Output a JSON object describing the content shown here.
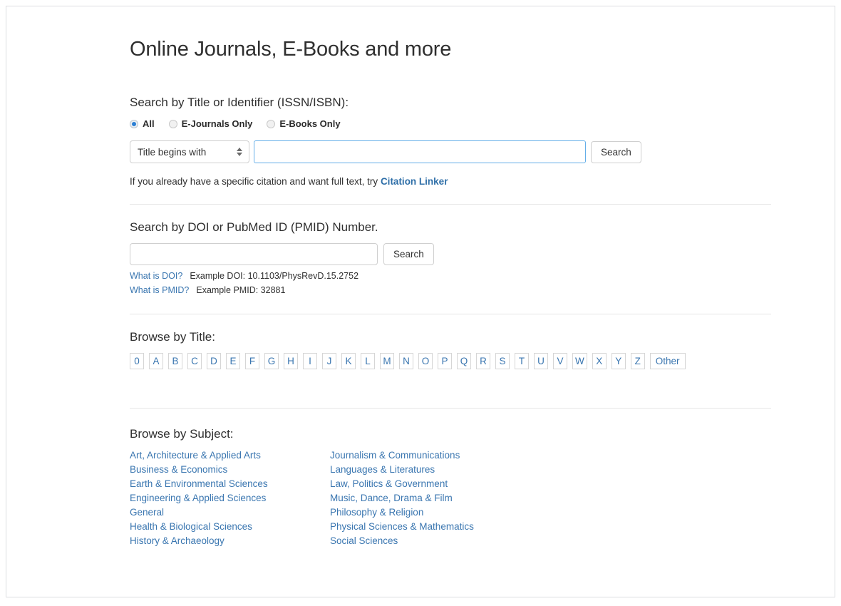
{
  "page": {
    "title": "Online Journals, E-Books and more"
  },
  "title_search": {
    "heading": "Search by Title or Identifier (ISSN/ISBN):",
    "radios": [
      {
        "label": "All",
        "checked": true
      },
      {
        "label": "E-Journals Only",
        "checked": false
      },
      {
        "label": "E-Books Only",
        "checked": false
      }
    ],
    "select_value": "Title begins with",
    "select_options": [
      "Title begins with"
    ],
    "input_value": "",
    "input_placeholder": "",
    "search_label": "Search",
    "hint_prefix": "If you already have a specific citation and want full text, try ",
    "hint_link": "Citation Linker"
  },
  "doi_search": {
    "heading": "Search by DOI or PubMed ID (PMID) Number.",
    "input_value": "",
    "input_placeholder": "",
    "search_label": "Search",
    "doi_link": "What is DOI?",
    "doi_example": "Example DOI: 10.1103/PhysRevD.15.2752",
    "pmid_link": "What is PMID?",
    "pmid_example": "Example PMID: 32881"
  },
  "browse_title": {
    "heading": "Browse by Title:",
    "letters": [
      "0",
      "A",
      "B",
      "C",
      "D",
      "E",
      "F",
      "G",
      "H",
      "I",
      "J",
      "K",
      "L",
      "M",
      "N",
      "O",
      "P",
      "Q",
      "R",
      "S",
      "T",
      "U",
      "V",
      "W",
      "X",
      "Y",
      "Z"
    ],
    "other_label": "Other"
  },
  "browse_subject": {
    "heading": "Browse by Subject:",
    "column_left": [
      "Art, Architecture & Applied Arts",
      "Business & Economics",
      "Earth & Environmental Sciences",
      "Engineering & Applied Sciences",
      "General",
      "Health & Biological Sciences",
      "History & Archaeology"
    ],
    "column_right": [
      "Journalism & Communications",
      "Languages & Literatures",
      "Law, Politics & Government",
      "Music, Dance, Drama & Film",
      "Philosophy & Religion",
      "Physical Sciences & Mathematics",
      "Social Sciences"
    ]
  },
  "colors": {
    "link": "#3a76b0",
    "accent": "#2b7fd4",
    "focus_border": "#64aee8",
    "text": "#2f2f2f",
    "divider": "#e6e6e6"
  }
}
